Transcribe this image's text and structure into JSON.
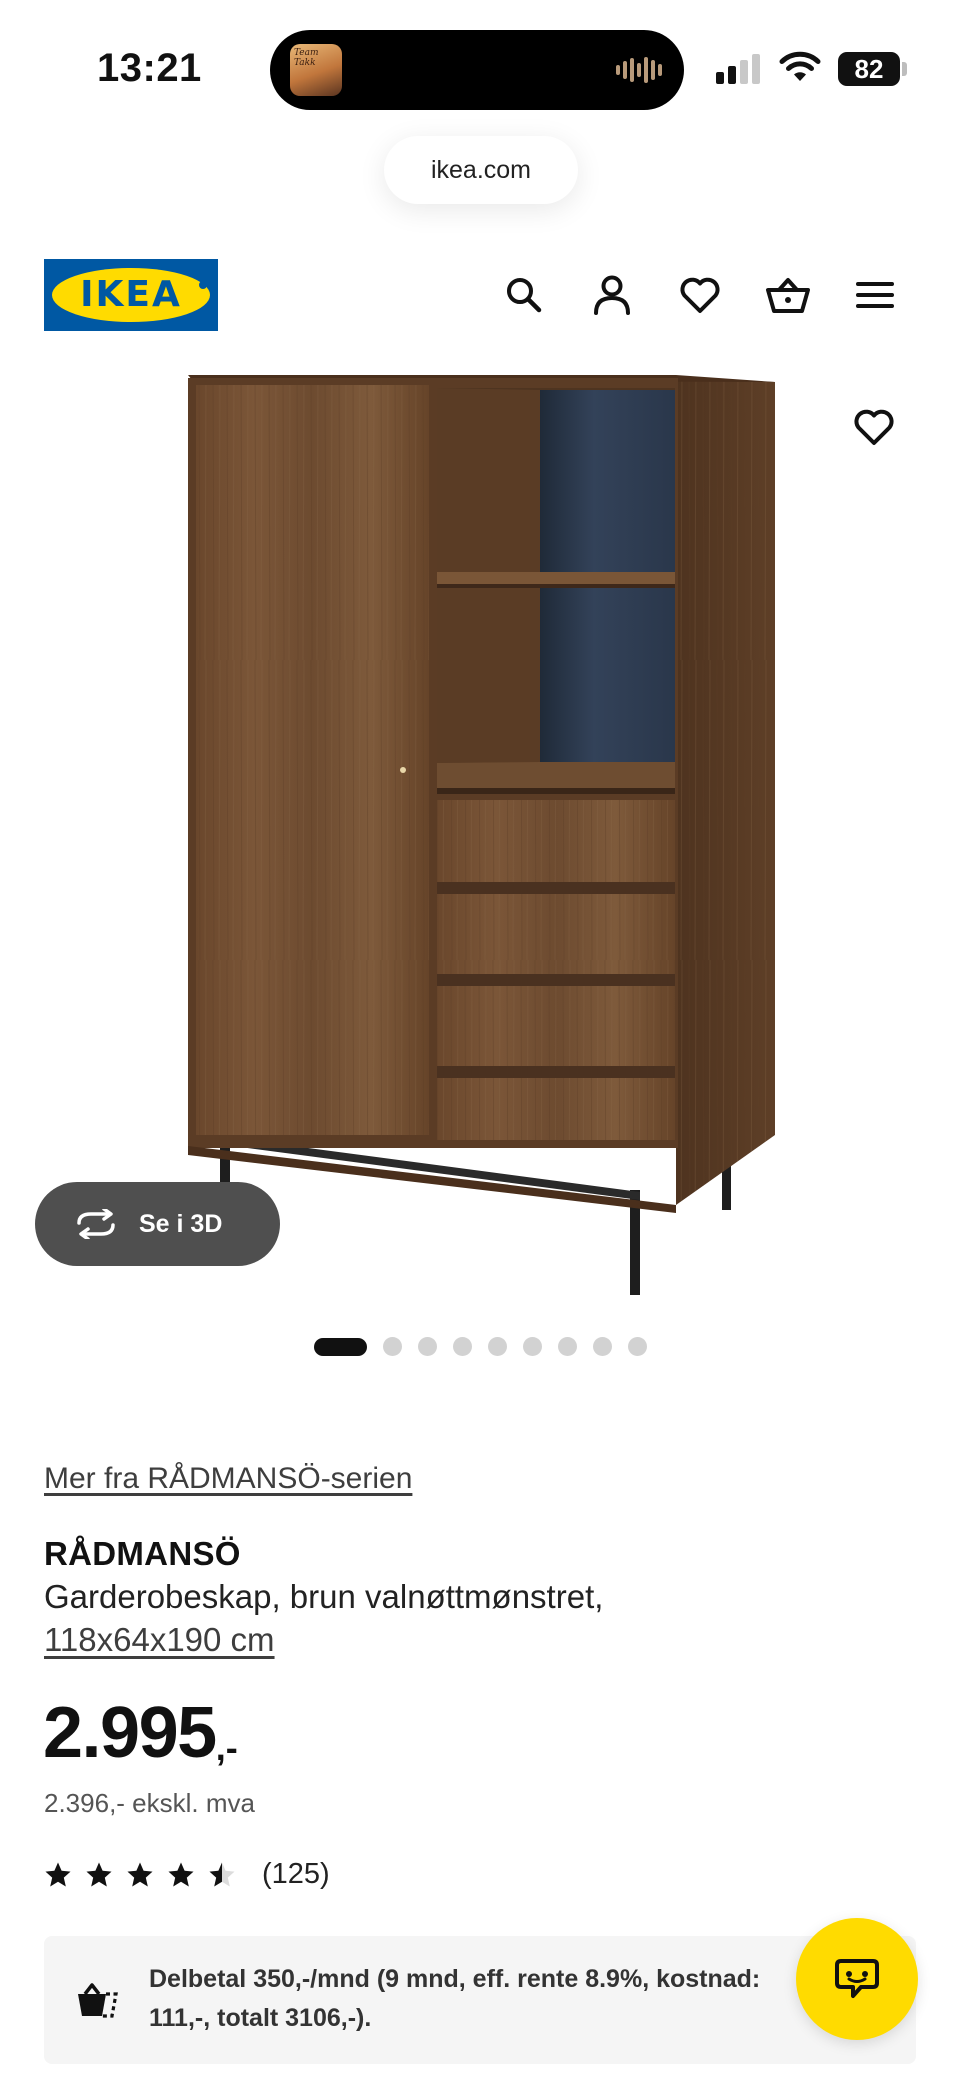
{
  "status_bar": {
    "time": "13:21",
    "battery": "82",
    "now_playing_art_text": "Team Takk"
  },
  "browser": {
    "url": "ikea.com"
  },
  "header": {
    "logo_text": "IKEA",
    "icons": [
      "search-icon",
      "account-icon",
      "wishlist-icon",
      "cart-icon",
      "menu-icon"
    ]
  },
  "gallery": {
    "button_3d_label": "Se i 3D",
    "image_count": 9,
    "active_index": 0
  },
  "product": {
    "series_link": "Mer fra RÅDMANSÖ-serien",
    "name": "RÅDMANSÖ",
    "description": "Garderobeskap, brun valnøttmønstret,",
    "size": "118x64x190 cm",
    "price": "2.995",
    "price_suffix": ",-",
    "price_ex_vat": "2.396,- ekskl. mva",
    "rating_value": 4.5,
    "rating_count": "(125)"
  },
  "financing": {
    "text": "Delbetal 350,-/mnd (9 mnd, eff. rente 8.9%, kostnad: 111,-, totalt 3106,-)."
  },
  "colors": {
    "ikea_blue": "#0058a3",
    "ikea_yellow": "#ffdb00",
    "cabinet_wood": "#6e4b2f",
    "cabinet_back_panel": "#2d3a4e"
  }
}
